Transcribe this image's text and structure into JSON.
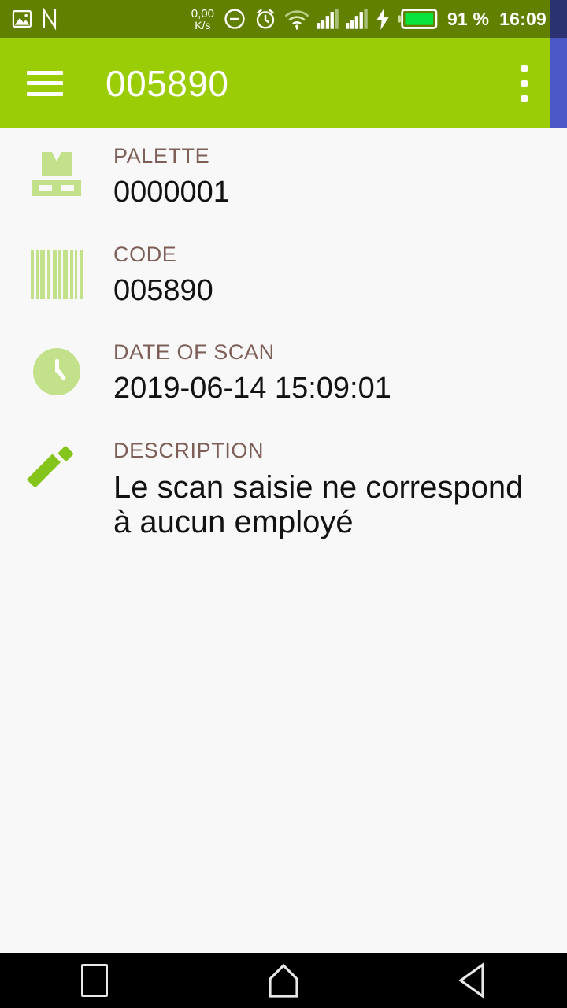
{
  "status_bar": {
    "left_icons": [
      {
        "name": "image-icon",
        "label": "screenshot"
      },
      {
        "name": "nfc-icon",
        "label": "N"
      }
    ],
    "network_speed": {
      "value": "0,00",
      "unit": "K/s"
    },
    "right_icons": [
      {
        "name": "do-not-disturb-icon"
      },
      {
        "name": "alarm-clock-icon"
      },
      {
        "name": "wifi-icon"
      },
      {
        "name": "signal-bars-sim1-icon"
      },
      {
        "name": "signal-bars-sim2-icon"
      },
      {
        "name": "charging-bolt-icon"
      },
      {
        "name": "battery-icon"
      }
    ],
    "battery_percent": "91 %",
    "time": "16:09",
    "background_color": "#628000"
  },
  "app_bar": {
    "menu_icon": "hamburger-menu-icon",
    "title": "005890",
    "overflow_icon": "more-vertical-icon",
    "background_color": "#9acd05"
  },
  "fields": [
    {
      "icon": "pallet-icon",
      "label": "PALETTE",
      "value": "0000001"
    },
    {
      "icon": "barcode-icon",
      "label": "CODE",
      "value": "005890"
    },
    {
      "icon": "clock-icon",
      "label": "DATE OF SCAN",
      "value": "2019-06-14 15:09:01"
    },
    {
      "icon": "pencil-icon",
      "label": "DESCRIPTION",
      "value": "Le scan saisie ne correspond à aucun employé"
    }
  ],
  "nav_bar": {
    "recents_label": "recents-square",
    "home_label": "home-pentagon",
    "back_label": "back-triangle",
    "background_color": "#000000"
  },
  "theme": {
    "label_color": "#7d5f57",
    "value_color": "#121212",
    "icon_green": "#c3e08a",
    "accent_green": "#9acd05",
    "content_background": "#f8f8f8"
  }
}
